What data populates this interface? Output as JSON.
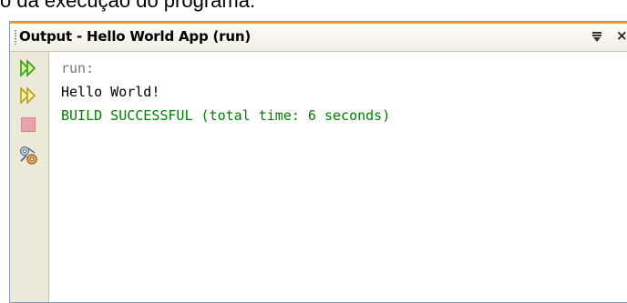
{
  "doc_caption": "o da execução do programa:",
  "window": {
    "title": "Output - Hello World App (run)",
    "menu_icon": "dropdown-menu-icon",
    "close_glyph": "×"
  },
  "toolbar": {
    "icons": [
      "rerun-icon",
      "rerun-with-options-icon",
      "stop-icon",
      "settings-icon"
    ]
  },
  "console": {
    "lines": [
      {
        "text": "run:",
        "kind": "muted"
      },
      {
        "text": "Hello World!",
        "kind": "normal"
      },
      {
        "text": "BUILD SUCCESSFUL (total time: 6 seconds)",
        "kind": "success"
      }
    ]
  },
  "colors": {
    "accent": "#f0a030",
    "success": "#008000",
    "muted": "#777777",
    "toolbar_bg": "#ece9d8"
  }
}
